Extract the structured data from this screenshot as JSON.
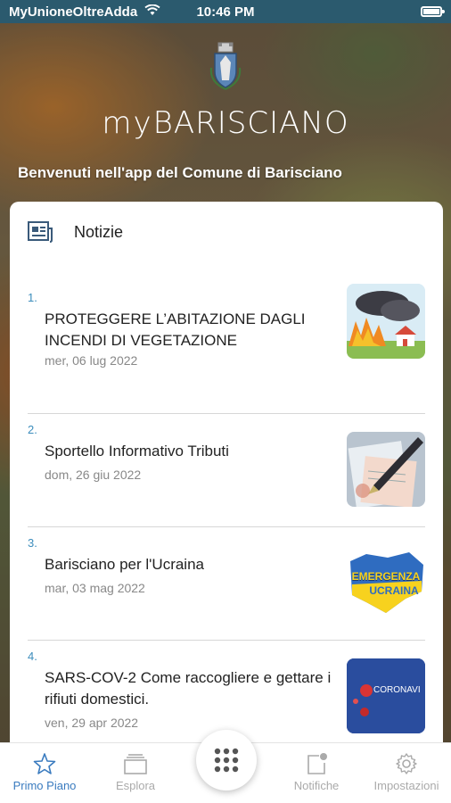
{
  "status_bar": {
    "carrier": "MyUnioneOltreAdda",
    "time": "10:46 PM"
  },
  "header": {
    "brand_prefix": "MY",
    "brand_name": "BARISCIANO",
    "welcome": "Benvenuti nell'app del Comune di Barisciano"
  },
  "news_card": {
    "title": "Notizie",
    "icon": "news-icon",
    "items": [
      {
        "number": "1.",
        "title": "PROTEGGERE L’ABITAZIONE DAGLI INCENDI DI VEGETAZIONE",
        "date": "mer, 06 lug 2022",
        "thumb": "fire-illustration"
      },
      {
        "number": "2.",
        "title": "Sportello Informativo Tributi",
        "date": "dom, 26 giu 2022",
        "thumb": "pen-documents"
      },
      {
        "number": "3.",
        "title": "Barisciano per l'Ucraina",
        "date": "mar, 03 mag 2022",
        "thumb_text_1": "EMERGENZA",
        "thumb_text_2": "UCRAINA"
      },
      {
        "number": "4.",
        "title": "SARS-COV-2 Come raccogliere e gettare i rifiuti domestici.",
        "date": "ven, 29 apr 2022",
        "thumb_text": "CORONAVI"
      }
    ]
  },
  "tabbar": {
    "tabs": [
      {
        "label": "Primo Piano",
        "icon": "star-icon",
        "active": true
      },
      {
        "label": "Esplora",
        "icon": "folder-icon",
        "active": false
      },
      {
        "label": "Notifiche",
        "icon": "notification-icon",
        "active": false
      },
      {
        "label": "Impostazioni",
        "icon": "gear-icon",
        "active": false
      }
    ],
    "center_icon": "grid-menu-icon"
  },
  "colors": {
    "status_bar": "#2b5a6e",
    "accent": "#3a7bbf",
    "number": "#3c8dbc"
  }
}
